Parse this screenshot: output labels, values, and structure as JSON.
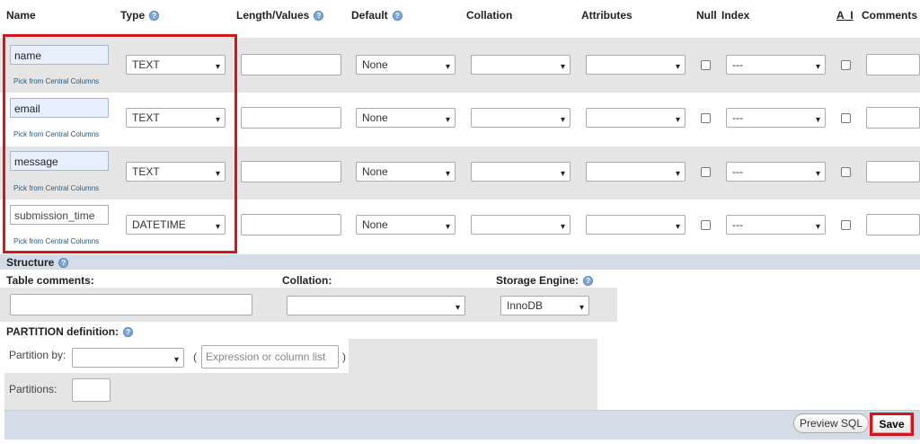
{
  "headers": {
    "name": "Name",
    "type": "Type",
    "length": "Length/Values",
    "default": "Default",
    "collation": "Collation",
    "attributes": "Attributes",
    "null": "Null",
    "index": "Index",
    "ai": "A_I",
    "comments": "Comments"
  },
  "pick_label": "Pick from Central Columns",
  "rows": [
    {
      "name": "name",
      "type": "TEXT",
      "default": "None",
      "index": "---"
    },
    {
      "name": "email",
      "type": "TEXT",
      "default": "None",
      "index": "---"
    },
    {
      "name": "message",
      "type": "TEXT",
      "default": "None",
      "index": "---"
    },
    {
      "name": "submission_time",
      "type": "DATETIME",
      "default": "None",
      "index": "---"
    }
  ],
  "structure": {
    "title": "Structure",
    "table_comments_label": "Table comments:",
    "collation_label": "Collation:",
    "storage_engine_label": "Storage Engine:",
    "storage_engine_value": "InnoDB"
  },
  "partition": {
    "title": "PARTITION definition:",
    "partition_by_label": "Partition by:",
    "expression_placeholder": "Expression or column list",
    "paren_open": "(",
    "paren_close": ")",
    "partitions_label": "Partitions:"
  },
  "footer": {
    "preview_sql": "Preview SQL",
    "save": "Save"
  },
  "colors": {
    "row_gray": "#e5e5e5",
    "section_blue": "#d3dce7",
    "highlight_red": "#d6141c"
  }
}
